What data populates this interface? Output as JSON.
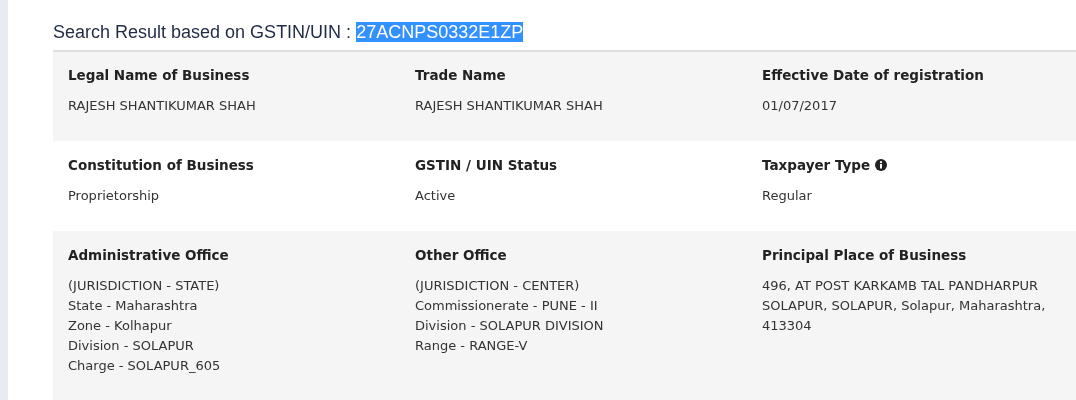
{
  "heading": {
    "label": "Search Result based on GSTIN/UIN : ",
    "gstin": "27ACNPS0332E1ZP",
    "highlighted": true
  },
  "rows": [
    {
      "fields": [
        {
          "label": "Legal Name of Business",
          "info": false,
          "lines": [
            "RAJESH SHANTIKUMAR SHAH"
          ]
        },
        {
          "label": "Trade Name",
          "info": false,
          "lines": [
            "RAJESH SHANTIKUMAR SHAH"
          ]
        },
        {
          "label": "Effective Date of registration",
          "info": false,
          "lines": [
            "01/07/2017"
          ]
        }
      ]
    },
    {
      "fields": [
        {
          "label": "Constitution of Business",
          "info": false,
          "lines": [
            "Proprietorship"
          ]
        },
        {
          "label": "GSTIN / UIN Status",
          "info": false,
          "lines": [
            "Active"
          ]
        },
        {
          "label": "Taxpayer Type",
          "info": true,
          "lines": [
            "Regular"
          ]
        }
      ]
    },
    {
      "fields": [
        {
          "label": "Administrative Office",
          "info": false,
          "lines": [
            "(JURISDICTION - STATE)",
            "State - Maharashtra",
            "Zone - Kolhapur",
            "Division - SOLAPUR",
            "Charge - SOLAPUR_605"
          ]
        },
        {
          "label": "Other Office",
          "info": false,
          "lines": [
            "(JURISDICTION - CENTER)",
            "Commissionerate - PUNE - II",
            "Division - SOLAPUR DIVISION",
            "Range - RANGE-V"
          ]
        },
        {
          "label": "Principal Place of Business",
          "info": false,
          "lines": [
            "496, AT POST KARKAMB TAL PANDHARPUR SOLAPUR, SOLAPUR, Solapur, Maharashtra, 413304"
          ]
        }
      ]
    }
  ]
}
